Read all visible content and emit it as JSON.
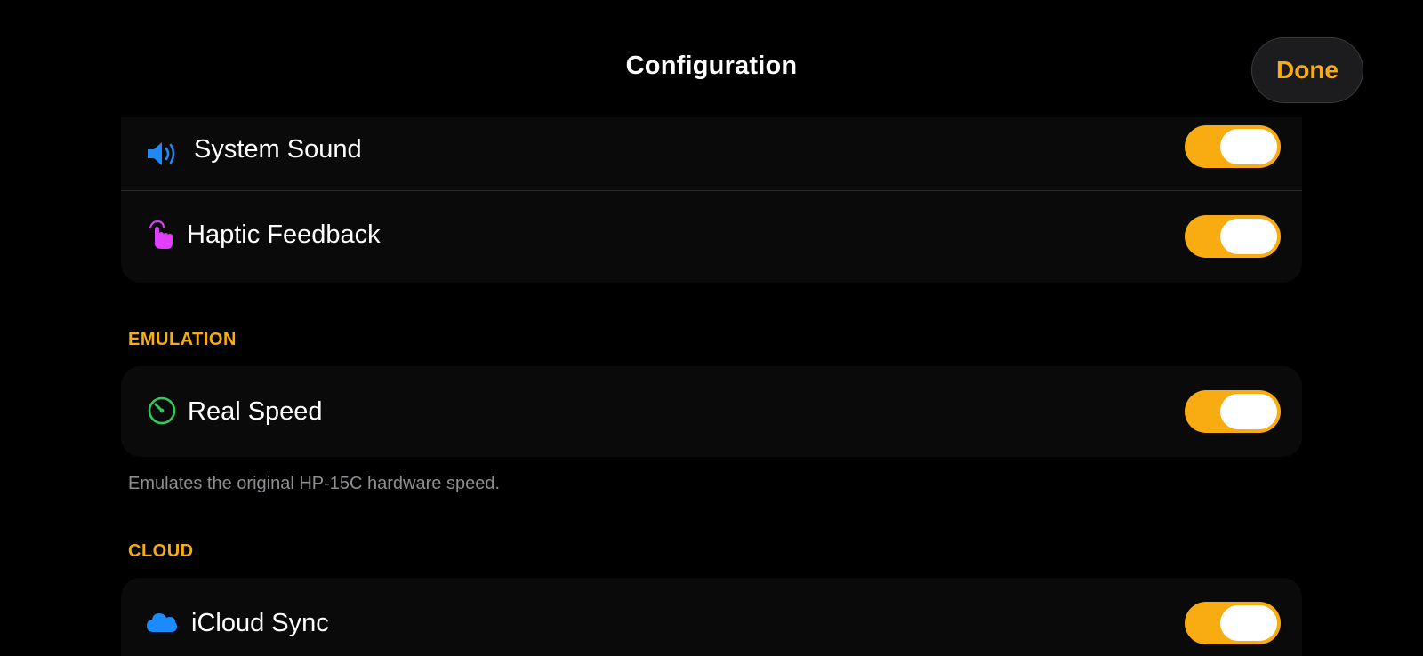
{
  "nav": {
    "title": "Configuration",
    "done_label": "Done"
  },
  "colors": {
    "accent": "#f8ac12",
    "background": "#000000",
    "cell_background": "#0a0a0a",
    "separator": "#2a2a2c",
    "footer_text": "#8e8e93",
    "system_sound_icon": "#1e88f5",
    "haptic_icon": "#e040fb",
    "real_speed_icon": "#34c759",
    "icloud_icon": "#1a8cff"
  },
  "sound_group": {
    "system_sound": {
      "label": "System Sound",
      "icon": "speaker-wave-icon",
      "enabled": true
    },
    "haptic_feedback": {
      "label": "Haptic Feedback",
      "icon": "hand-tap-icon",
      "enabled": true
    }
  },
  "emulation": {
    "header": "EMULATION",
    "real_speed": {
      "label": "Real Speed",
      "icon": "speedometer-icon",
      "enabled": true
    },
    "footer": "Emulates the original HP-15C hardware speed."
  },
  "cloud": {
    "header": "CLOUD",
    "icloud_sync": {
      "label": "iCloud Sync",
      "icon": "cloud-icon",
      "enabled": true
    }
  }
}
